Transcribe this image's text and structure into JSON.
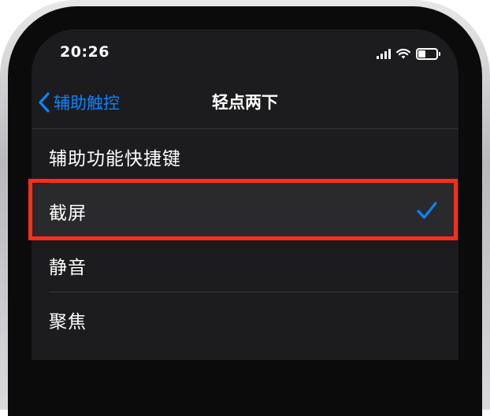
{
  "status_bar": {
    "time": "20:26",
    "icons": [
      "cellular-signal-icon",
      "wifi-icon",
      "battery-icon"
    ]
  },
  "nav": {
    "back_label": "辅助触控",
    "title": "轻点两下"
  },
  "list": {
    "items": [
      {
        "label": "辅助功能快捷键",
        "selected": false
      },
      {
        "label": "截屏",
        "selected": true
      },
      {
        "label": "静音",
        "selected": false
      },
      {
        "label": "聚焦",
        "selected": false
      }
    ]
  },
  "colors": {
    "accent": "#0a84ff",
    "background": "#1c1c1e",
    "highlight_box": "#ff2d1b",
    "text": "#ffffff"
  }
}
